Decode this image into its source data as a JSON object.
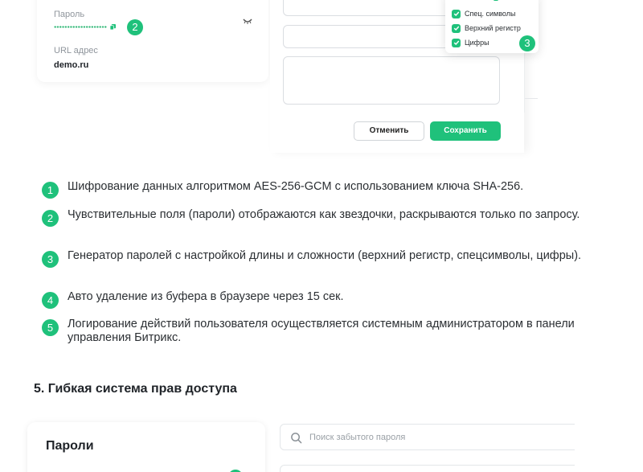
{
  "form_card": {
    "password_label": "Пароль",
    "password_badge": "2",
    "url_label": "URL адрес",
    "url_value": "demo.ru"
  },
  "edit_form": {
    "cancel_label": "Отменить",
    "save_label": "Сохранить"
  },
  "generator_popup": {
    "options": [
      {
        "label": "Спец. символы",
        "checked": true
      },
      {
        "label": "Верхний регистр",
        "checked": true
      },
      {
        "label": "Цифры",
        "checked": true
      }
    ],
    "badge": "3"
  },
  "features": [
    {
      "num": "1",
      "text": "Шифрование данных алгоритмом AES-256-GCM с использованием ключа SHA-256."
    },
    {
      "num": "2",
      "text": "Чувствительные поля (пароли) отображаются как звездочки, раскрываются только по запросу."
    },
    {
      "num": "3",
      "text": "Генератор паролей с настройкой длины и сложности (верхний регистр, спецсимволы, цифры)."
    },
    {
      "num": "4",
      "text": "Авто удаление из буфера в браузере через 15 сек."
    },
    {
      "num": "5",
      "text": "Логирование действий пользователя осуществляется системным администратором в панели управления Битрикс."
    }
  ],
  "section": {
    "title": "5. Гибкая система прав доступа"
  },
  "passwords_card": {
    "title": "Пароли"
  },
  "search": {
    "placeholder": "Поиск забытого пароля",
    "value": ""
  },
  "colors": {
    "accent": "#1fc17b",
    "text": "#2b2f33",
    "muted": "#8f959c"
  }
}
